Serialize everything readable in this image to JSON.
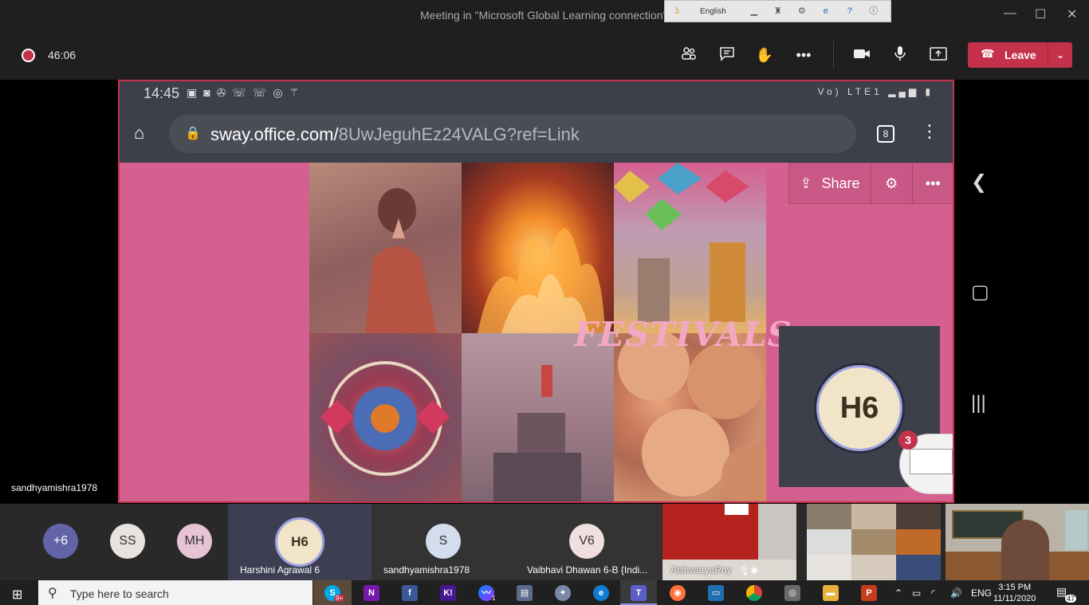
{
  "window": {
    "title": "Meeting in \"Microsoft Global Learning connection\"",
    "language": "English",
    "controls": {
      "minimize": "—",
      "maximize": "☐",
      "close": "✕"
    }
  },
  "meeting": {
    "timer": "46:06",
    "leave_label": "Leave",
    "icons": [
      "participants-icon",
      "chat-icon",
      "raise-hand-icon",
      "more-icon",
      "camera-icon",
      "mic-icon",
      "share-icon"
    ]
  },
  "shared": {
    "phone_time": "14:45",
    "url_domain": "sway.office.com/",
    "url_rest": "8UwJeguhEz24VALG?ref=Link",
    "tab_count": "8",
    "share_label": "Share",
    "festivals_title": "FESTIVALS",
    "self_initials": "H6",
    "notif_count": "3",
    "status_right": "Vo) LTE1"
  },
  "presenter_name": "sandhyamishra1978",
  "participants": {
    "more_count": "+6",
    "circles": [
      {
        "initials": "SS",
        "bg": "#e8e3dd",
        "fg": "#333"
      },
      {
        "initials": "MH",
        "bg": "#e7c4d5",
        "fg": "#333"
      }
    ],
    "tiles": [
      {
        "initials": "H6",
        "name": "Harshini Agrawal 6"
      },
      {
        "initials": "S",
        "name": "sandhyamishra1978"
      },
      {
        "initials": "V6",
        "name": "Vaibhavi Dhawan 6-B {Indi..."
      }
    ],
    "video_name": "AishwaryaRoy"
  },
  "taskbar": {
    "search_placeholder": "Type here to search",
    "skype_badge": "9+",
    "messenger_badge": "1",
    "lang": "ENG",
    "time": "3:15 PM",
    "date": "11/11/2020",
    "notif": "47"
  }
}
